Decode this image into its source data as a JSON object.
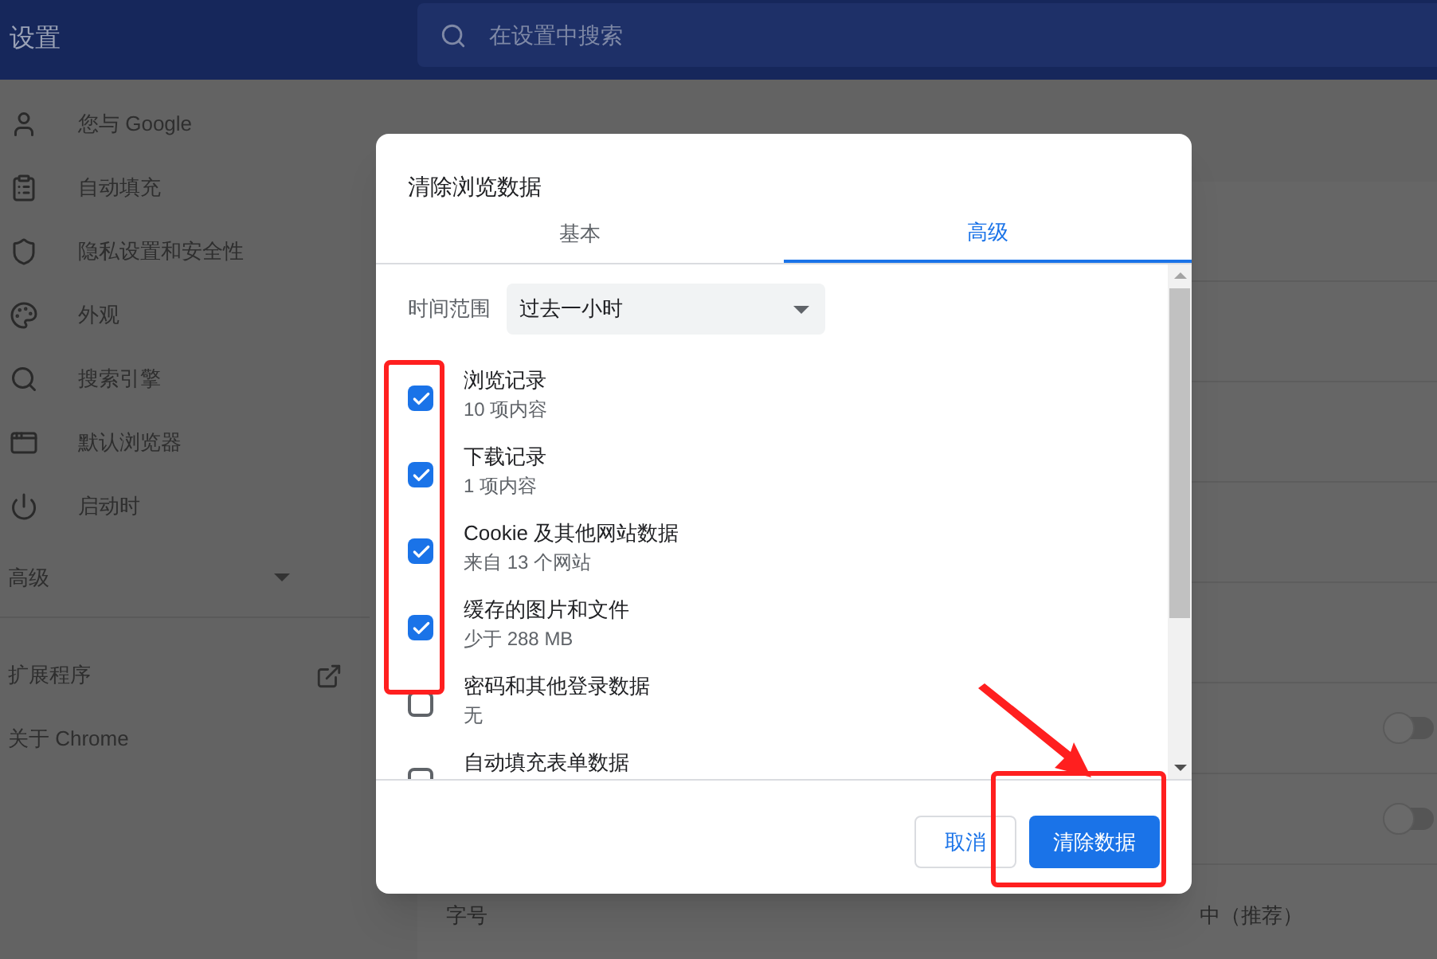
{
  "header": {
    "title": "设置",
    "search": {
      "placeholder": "在设置中搜索"
    }
  },
  "sidebar": {
    "items": [
      {
        "label": "您与 Google"
      },
      {
        "label": "自动填充"
      },
      {
        "label": "隐私设置和安全性"
      },
      {
        "label": "外观"
      },
      {
        "label": "搜索引擎"
      },
      {
        "label": "默认浏览器"
      },
      {
        "label": "启动时"
      }
    ],
    "advanced": {
      "label": "高级",
      "expanded": false
    },
    "links": [
      {
        "label": "扩展程序",
        "external": true
      },
      {
        "label": "关于 Chrome",
        "external": false
      }
    ]
  },
  "settings": {
    "toggles": [
      {
        "on": false
      },
      {
        "on": false
      }
    ],
    "font_size": {
      "label": "字号",
      "value": "中（推荐）"
    }
  },
  "dialog": {
    "title": "清除浏览数据",
    "tabs": [
      {
        "label": "基本",
        "selected": false
      },
      {
        "label": "高级",
        "selected": true
      }
    ],
    "time_range": {
      "label": "时间范围",
      "value": "过去一小时"
    },
    "items": [
      {
        "label": "浏览记录",
        "detail": "10 项内容",
        "checked": true
      },
      {
        "label": "下载记录",
        "detail": "1 项内容",
        "checked": true
      },
      {
        "label": "Cookie 及其他网站数据",
        "detail": "来自 13 个网站",
        "checked": true
      },
      {
        "label": "缓存的图片和文件",
        "detail": "少于 288 MB",
        "checked": true
      },
      {
        "label": "密码和其他登录数据",
        "detail": "无",
        "checked": false
      },
      {
        "label": "自动填充表单数据",
        "checked": false
      }
    ],
    "buttons": {
      "cancel": "取消",
      "confirm": "清除数据"
    }
  }
}
